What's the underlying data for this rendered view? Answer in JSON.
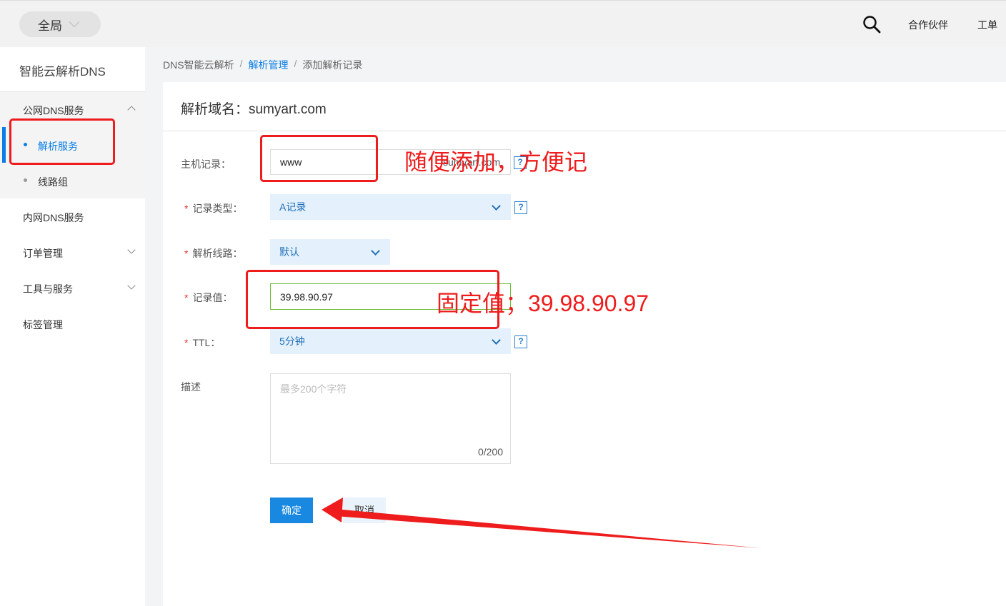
{
  "topbar": {
    "scope_label": "全局",
    "partner_label": "合作伙伴",
    "ticket_label": "工单"
  },
  "sidebar": {
    "title": "智能云解析DNS",
    "items": [
      {
        "label": "公网DNS服务"
      },
      {
        "label": "解析服务"
      },
      {
        "label": "线路组"
      },
      {
        "label": "内网DNS服务"
      },
      {
        "label": "订单管理"
      },
      {
        "label": "工具与服务"
      },
      {
        "label": "标签管理"
      }
    ]
  },
  "breadcrumb": {
    "root": "DNS智能云解析",
    "parent": "解析管理",
    "current": "添加解析记录",
    "sep": "/"
  },
  "form": {
    "title": "解析域名：sumyart.com",
    "host": {
      "label": "主机记录：",
      "value": "www",
      "suffix": "sumyart.com"
    },
    "type": {
      "label": "记录类型：",
      "value": "A记录"
    },
    "line": {
      "label": "解析线路：",
      "value": "默认"
    },
    "record_value": {
      "label": "记录值：",
      "value": "39.98.90.97"
    },
    "ttl": {
      "label": "TTL：",
      "value": "5分钟"
    },
    "desc": {
      "label": "描述",
      "placeholder": "最多200个字符",
      "counter": "0/200"
    },
    "help": "?",
    "required_mark": "*",
    "confirm_label": "确定",
    "cancel_label": "取消"
  },
  "annotations": {
    "note1": "随便添加，方便记",
    "note2": "固定值；39.98.90.97",
    "color": "#ee1c1c"
  }
}
